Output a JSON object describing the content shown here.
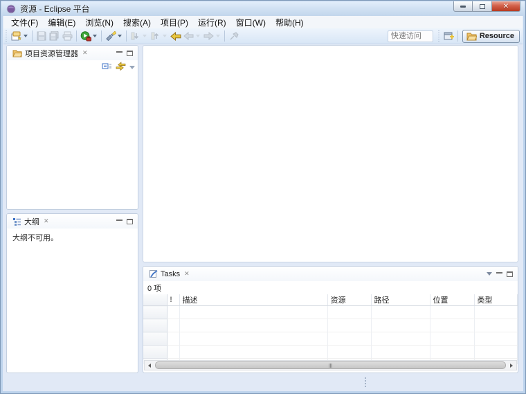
{
  "window": {
    "title": "资源 - Eclipse 平台",
    "controls": {
      "minimize": "minimize",
      "restore": "restore",
      "close": "close"
    }
  },
  "menu": {
    "items": [
      "文件(F)",
      "编辑(E)",
      "浏览(N)",
      "搜索(A)",
      "项目(P)",
      "运行(R)",
      "窗口(W)",
      "帮助(H)"
    ]
  },
  "toolbar": {
    "icons": [
      "new-wizard",
      "save",
      "save-all",
      "print",
      "run-external-tools",
      "search",
      "next-annotation",
      "previous-annotation",
      "last-edit-location",
      "back",
      "forward",
      "pin-editor"
    ],
    "quick_access_placeholder": "快速访问",
    "open_perspective_icon": "open-perspective",
    "perspective_label": "Resource"
  },
  "panels": {
    "project_explorer": {
      "title": "项目资源管理器",
      "local_icons": [
        "collapse-all",
        "link-with-editor",
        "view-menu"
      ]
    },
    "outline": {
      "title": "大纲",
      "message": "大纲不可用。"
    },
    "tasks": {
      "title": "Tasks",
      "count_label": "0 项",
      "columns": [
        "!",
        "描述",
        "资源",
        "路径",
        "位置",
        "类型"
      ],
      "rows": []
    }
  },
  "colors": {
    "titlebar_top": "#e3eefb",
    "titlebar_bottom": "#c2d6ec",
    "toolbar_top": "#edf4fc",
    "toolbar_bottom": "#d8e6f6",
    "frame_border": "#bdd3ec",
    "close_button": "#d2604a",
    "workspace_bg": "#e1e9f6",
    "panel_border": "#c3cfe0",
    "folder_icon": "#f0c36a",
    "run_icon_green": "#3da639",
    "nav_arrow_yellow": "#d8a62a"
  }
}
